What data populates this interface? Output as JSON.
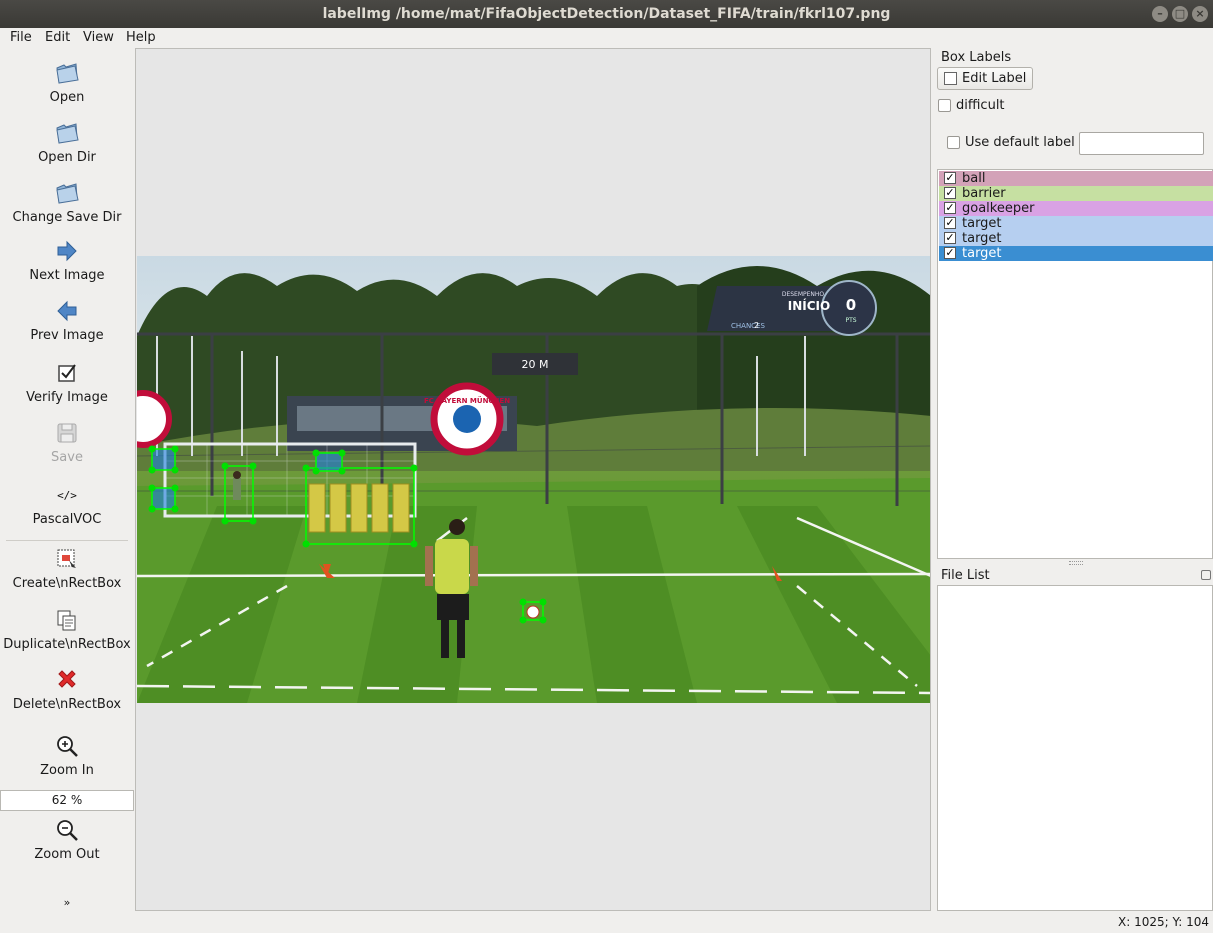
{
  "window": {
    "title": "labelImg /home/mat/FifaObjectDetection/Dataset_FIFA/train/fkrl107.png"
  },
  "menu": [
    "File",
    "Edit",
    "View",
    "Help"
  ],
  "toolbar": {
    "open": "Open",
    "open_dir": "Open Dir",
    "change_save_dir": "Change Save Dir",
    "next_image": "Next Image",
    "prev_image": "Prev Image",
    "verify_image": "Verify Image",
    "save": "Save",
    "format": "PascalVOC",
    "create_rect": "Create\\nRectBox",
    "duplicate_rect": "Duplicate\\nRectBox",
    "delete_rect": "Delete\\nRectBox",
    "zoom_in": "Zoom In",
    "zoom_value": "62 %",
    "zoom_out": "Zoom Out",
    "more": "»"
  },
  "box_labels": {
    "title": "Box Labels",
    "edit_label_button": "Edit Label",
    "difficult_label": "difficult",
    "use_default_label": "Use default label",
    "default_label_value": "",
    "items": [
      {
        "label": "ball",
        "checked": true,
        "color": "#d3a2b8"
      },
      {
        "label": "barrier",
        "checked": true,
        "color": "#c6e0a2"
      },
      {
        "label": "goalkeeper",
        "checked": true,
        "color": "#d9a2e4"
      },
      {
        "label": "target",
        "checked": true,
        "color": "#b6cff0"
      },
      {
        "label": "target",
        "checked": true,
        "color": "#b6cff0"
      },
      {
        "label": "target",
        "checked": true,
        "color": "#3a8ed2",
        "selected": true
      }
    ]
  },
  "file_list": {
    "title": "File List",
    "files": []
  },
  "scene": {
    "sign_distance": "20 M",
    "scoreboard_top": "DESEMPENHO",
    "scoreboard_main": "INÍCIO",
    "scoreboard_chances_label": "CHANCES",
    "scoreboard_chances_value": "2",
    "scoreboard_points": "0",
    "scoreboard_points_unit": "PTS",
    "club_logo_text": "FC BAYERN MÜNCHEN"
  },
  "status": {
    "coords": "X: 1025; Y: 104"
  }
}
